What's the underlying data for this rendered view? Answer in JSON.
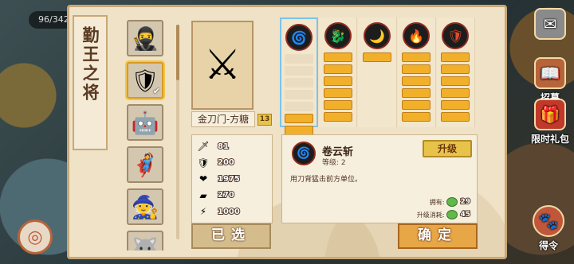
{
  "hud": {
    "counter": "96/342"
  },
  "side": {
    "top_right_label": "",
    "btn1": "招募",
    "btn2": "限时礼包",
    "btn3": "得令"
  },
  "panel": {
    "title": "勤王之将",
    "heroes": [
      {
        "icon": "🥷",
        "selected": false
      },
      {
        "icon": "🛡",
        "selected": true,
        "check": "✔"
      },
      {
        "icon": "🤖",
        "selected": false
      },
      {
        "icon": "🦸",
        "selected": false
      },
      {
        "icon": "🧙",
        "selected": false
      },
      {
        "icon": "🐺",
        "selected": false
      }
    ],
    "hero": {
      "name": "金刀门-方糖",
      "level": "13",
      "portrait": "⚔"
    },
    "stats": [
      {
        "icon": "sword-icon",
        "glyph": "🗡",
        "value": "81"
      },
      {
        "icon": "shield-icon",
        "glyph": "🛡",
        "value": "200"
      },
      {
        "icon": "heart-icon",
        "glyph": "❤",
        "value": "1975"
      },
      {
        "icon": "armor-icon",
        "glyph": "▰",
        "value": "270"
      },
      {
        "icon": "lightning-icon",
        "glyph": "⚡",
        "value": "1000"
      }
    ],
    "skills": [
      {
        "glyph": "🌀",
        "filled": 2,
        "total": 7,
        "selected": true
      },
      {
        "glyph": "🐉",
        "filled": 6,
        "total": 6,
        "selected": false
      },
      {
        "glyph": "🌙",
        "filled": 1,
        "total": 1,
        "selected": false
      },
      {
        "glyph": "🔥",
        "filled": 6,
        "total": 6,
        "selected": false
      },
      {
        "glyph": "🛡",
        "filled": 6,
        "total": 6,
        "selected": false
      }
    ],
    "detail": {
      "name": "卷云斩",
      "level": "等级: 2",
      "desc": "用刀背猛击前方单位。",
      "upgrade": "升级",
      "own_label": "拥有:",
      "own_value": "29",
      "cost_label": "升级消耗:",
      "cost_value": "45"
    },
    "btn_selected": "已选",
    "btn_confirm": "确定"
  }
}
